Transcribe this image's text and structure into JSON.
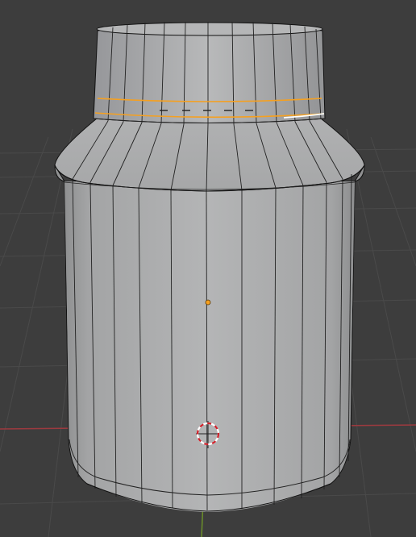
{
  "viewport": {
    "mode": "Edit Mode",
    "shading": "Solid",
    "background_color": "#3d3d3d",
    "grid_color": "#4a4a4a",
    "x_axis_color": "#9c3a3f",
    "y_axis_color": "#6b8f2a"
  },
  "mesh": {
    "object": "bottle",
    "surface_color": "#a9aaab",
    "wire_color": "#111111",
    "selected_loop_color": "#f5a020",
    "active_edge_color": "#ffffff"
  },
  "markers": {
    "origin_icon": "origin-dot",
    "cursor_icon": "3d-cursor"
  }
}
